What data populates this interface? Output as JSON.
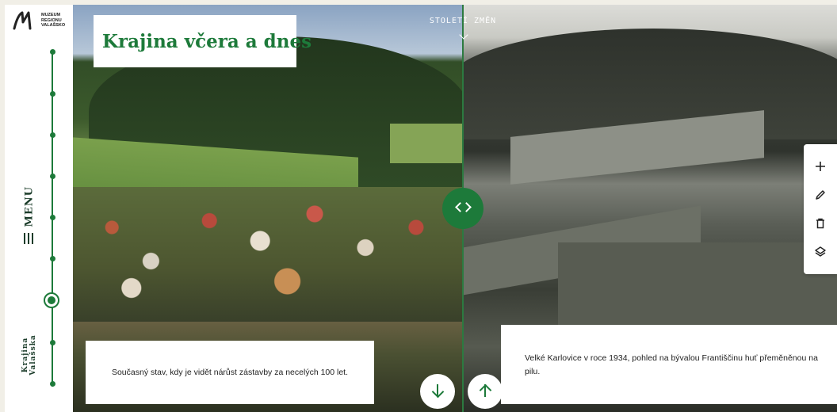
{
  "sidebar": {
    "logo_lines": [
      "MUZEUM",
      "REGIONU",
      "VALAŠSKO"
    ],
    "menu_label": "MENU",
    "section_name": "Krajina Valašska",
    "timeline": {
      "count": 9,
      "active_index": 6
    }
  },
  "header": {
    "title": "Krajina včera a dnes",
    "section_label": "STOLETÍ ZMĚN"
  },
  "captions": {
    "left": "Současný stav, kdy je vidět nárůst zástavby za necelých 100 let.",
    "right": "Velké Karlovice v roce 1934, pohled na bývalou Františčinu huť přeměněnou na pilu."
  },
  "tools": [
    "plus-icon",
    "pencil-icon",
    "trash-icon",
    "layers-icon"
  ],
  "colors": {
    "accent": "#1d7a3a",
    "text_dark": "#1b3c2a"
  }
}
